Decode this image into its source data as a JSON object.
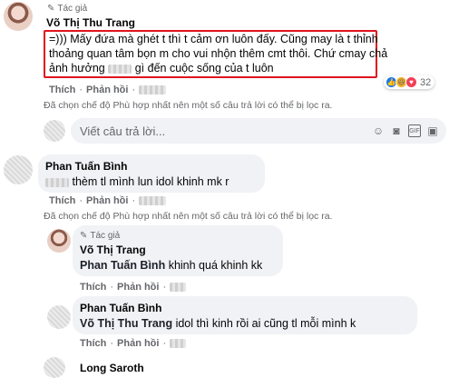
{
  "comment1": {
    "author_tag": "Tác giả",
    "name": "Võ Thị Thu Trang",
    "line1": "=))) Mấy đứa mà ghét t thì t cảm ơn luôn đấy. Cũng may là t thỉnh",
    "line2": "thoảng quan tâm bọn m cho vui nhộn thêm cmt thôi. Chứ cmay chả",
    "line3a": "ảnh hưởng",
    "line3b": "gì đến cuộc sống của t luôn",
    "like": "Thích",
    "reply": "Phản hồi",
    "reaction_count": "32",
    "filter_note": "Đã chọn chế độ Phù hợp nhất nên một số câu trả lời có thể bị lọc ra."
  },
  "reply_input": {
    "placeholder": "Viết câu trả lời..."
  },
  "comment2": {
    "name": "Phan Tuấn Bình",
    "text": "thèm tl mình lun idol khinh mk r",
    "like": "Thích",
    "reply": "Phản hồi",
    "filter_note": "Đã chọn chế độ Phù hợp nhất nên một số câu trả lời có thể bị lọc ra."
  },
  "reply1": {
    "author_tag": "Tác giả",
    "name": "Võ Thị Trang",
    "mention": "Phan Tuấn Bình",
    "text": "khinh quá khinh kk",
    "like": "Thích",
    "reply": "Phản hồi"
  },
  "reply2": {
    "name": "Phan Tuấn Bình",
    "mention": "Võ Thị Thu Trang",
    "text": "idol thì kinh rồi ai cũng tl mỗi mình k",
    "like": "Thích",
    "reply": "Phản hồi"
  },
  "comment3": {
    "name": "Long Saroth"
  },
  "colors": {
    "highlight": "#e0141e",
    "bubble": "#f0f2f5",
    "muted": "#65676b"
  },
  "icons": [
    "pencil-icon",
    "like-reaction-icon",
    "haha-reaction-icon",
    "love-reaction-icon",
    "emoji-icon",
    "camera-icon",
    "gif-icon",
    "sticker-icon"
  ]
}
